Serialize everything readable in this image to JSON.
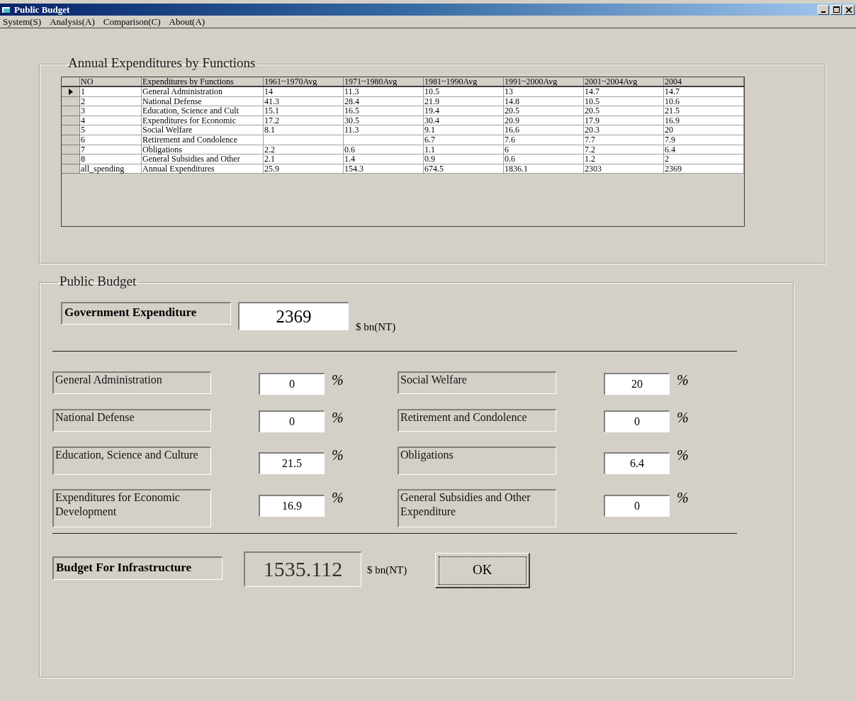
{
  "window": {
    "title": "Public Budget"
  },
  "menu": [
    "System(S)",
    "Analysis(A)",
    "Comparison(C)",
    "About(A)"
  ],
  "expenditures_group": {
    "title": "Annual Expenditures by Functions",
    "table": {
      "columns": [
        "NO",
        "Expenditures by Functions",
        "1961~1970Avg",
        "1971~1980Avg",
        "1981~1990Avg",
        "1991~2000Avg",
        "2001~2004Avg",
        "2004"
      ],
      "rows": [
        {
          "selected": true,
          "cells": [
            "1",
            "General Administration",
            "14",
            "11.3",
            "10.5",
            "13",
            "14.7",
            "14.7"
          ]
        },
        {
          "selected": false,
          "cells": [
            "2",
            "National Defense",
            "41.3",
            "28.4",
            "21.9",
            "14.8",
            "10.5",
            "10.6"
          ]
        },
        {
          "selected": false,
          "cells": [
            "3",
            "Education, Science and Cult",
            "15.1",
            "16.5",
            "19.4",
            "20.5",
            "20.5",
            "21.5"
          ]
        },
        {
          "selected": false,
          "cells": [
            "4",
            "Expenditures for Economic",
            "17.2",
            "30.5",
            "30.4",
            "20.9",
            "17.9",
            "16.9"
          ]
        },
        {
          "selected": false,
          "cells": [
            "5",
            "Social Welfare",
            "8.1",
            "11.3",
            "9.1",
            "16.6",
            "20.3",
            "20"
          ]
        },
        {
          "selected": false,
          "cells": [
            "6",
            "Retirement and Condolence",
            null,
            null,
            "6.7",
            "7.6",
            "7.7",
            "7.9"
          ]
        },
        {
          "selected": false,
          "cells": [
            "7",
            "Obligations",
            "2.2",
            "0.6",
            "1.1",
            "6",
            "7.2",
            "6.4"
          ]
        },
        {
          "selected": false,
          "cells": [
            "8",
            "General Subsidies and Other",
            "2.1",
            "1.4",
            "0.9",
            "0.6",
            "1.2",
            "2"
          ]
        },
        {
          "selected": false,
          "cells": [
            "all_spending",
            "Annual Expenditures",
            "25.9",
            "154.3",
            "674.5",
            "1836.1",
            "2303",
            "2369"
          ]
        }
      ]
    }
  },
  "budget_group": {
    "title": "Public Budget",
    "government_expenditure": {
      "label": "Government Expenditure",
      "value": "2369",
      "unit": "$ bn(NT)"
    },
    "left_items": [
      {
        "label": "General Administration",
        "value": "0",
        "unit": "%"
      },
      {
        "label": "National Defense",
        "value": "0",
        "unit": "%"
      },
      {
        "label": "Education, Science and Culture",
        "value": "21.5",
        "unit": "%"
      },
      {
        "label": "Expenditures for Economic Development",
        "value": "16.9",
        "unit": "%"
      }
    ],
    "right_items": [
      {
        "label": "Social Welfare",
        "value": "20",
        "unit": "%"
      },
      {
        "label": "Retirement and Condolence",
        "value": "0",
        "unit": "%"
      },
      {
        "label": "Obligations",
        "value": "6.4",
        "unit": "%"
      },
      {
        "label": "General Subsidies and Other Expenditure",
        "value": "0",
        "unit": "%"
      }
    ],
    "infrastructure": {
      "label": "Budget For Infrastructure",
      "value": "1535.112",
      "unit": "$ bn(NT)",
      "readonly": true
    },
    "ok_button": {
      "label": "OK",
      "focused": true
    }
  }
}
